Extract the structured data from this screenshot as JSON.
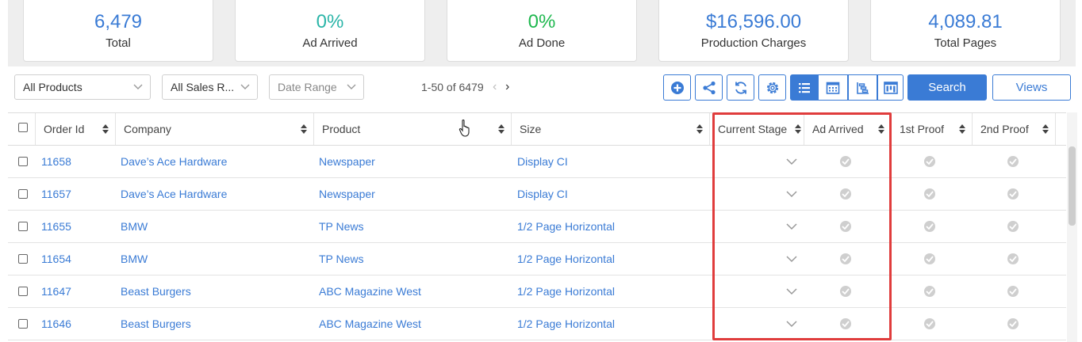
{
  "stats": [
    {
      "value": "6,479",
      "label": "Total",
      "color": "#3a7bd5"
    },
    {
      "value": "0%",
      "label": "Ad Arrived",
      "color": "#2bb5a8"
    },
    {
      "value": "0%",
      "label": "Ad Done",
      "color": "#1fb84f"
    },
    {
      "value": "$16,596.00",
      "label": "Production Charges",
      "color": "#3a7bd5"
    },
    {
      "value": "4,089.81",
      "label": "Total Pages",
      "color": "#3a7bd5"
    }
  ],
  "filters": {
    "products": "All Products",
    "sales_rep": "All Sales R...",
    "date_range": "Date Range"
  },
  "pager": {
    "text": "1-50 of 6479",
    "prev": "‹",
    "next": "›"
  },
  "toolbar": {
    "icons": [
      "add-icon",
      "share-icon",
      "refresh-icon",
      "settings-icon",
      "list-view-icon",
      "calendar-view-icon",
      "gantt-view-icon",
      "board-view-icon"
    ],
    "search_label": "Search",
    "views_label": "Views"
  },
  "table": {
    "columns": [
      "Order Id",
      "Company",
      "Product",
      "Size",
      "Current Stage",
      "Ad Arrived",
      "1st Proof",
      "2nd Proof"
    ],
    "rows": [
      {
        "order_id": "11658",
        "company": "Dave’s Ace Hardware",
        "product": "Newspaper",
        "size": "Display CI"
      },
      {
        "order_id": "11657",
        "company": "Dave’s Ace Hardware",
        "product": "Newspaper",
        "size": "Display CI"
      },
      {
        "order_id": "11655",
        "company": "BMW",
        "product": "TP News",
        "size": "1/2 Page Horizontal"
      },
      {
        "order_id": "11654",
        "company": "BMW",
        "product": "TP News",
        "size": "1/2 Page Horizontal"
      },
      {
        "order_id": "11647",
        "company": "Beast Burgers",
        "product": "ABC Magazine West",
        "size": "1/2 Page Horizontal"
      },
      {
        "order_id": "11646",
        "company": "Beast Burgers",
        "product": "ABC Magazine West",
        "size": "1/2 Page Horizontal"
      }
    ]
  },
  "colors": {
    "accent": "#3a7bd5",
    "highlight": "#e03c3c"
  }
}
